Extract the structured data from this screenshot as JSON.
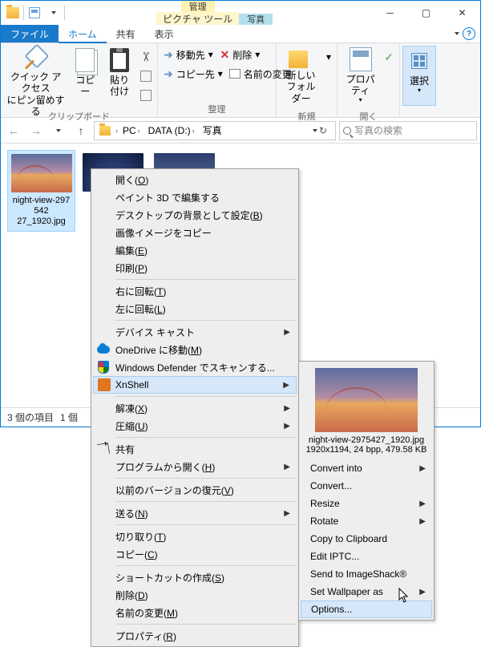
{
  "titlebar": {
    "contextual": [
      {
        "header": "管理",
        "tab": "ピクチャ ツール",
        "color": "yellow"
      },
      {
        "header": "写真",
        "tab": "",
        "color": "cyan"
      }
    ]
  },
  "ribbon_tabs": {
    "file": "ファイル",
    "home": "ホーム",
    "share": "共有",
    "view": "表示"
  },
  "ribbon": {
    "clipboard": {
      "label": "クリップボード",
      "pin": "クイック アクセス\nにピン留めする",
      "copy": "コピー",
      "paste": "貼り付け"
    },
    "organize": {
      "label": "整理",
      "move": "移動先",
      "delete": "削除",
      "copy_to": "コピー先",
      "rename": "名前の変更"
    },
    "new": {
      "label": "新規",
      "newfolder": "新しい\nフォルダー"
    },
    "open": {
      "label": "開く",
      "props": "プロパティ"
    },
    "select": {
      "label": "",
      "btn": "選択"
    }
  },
  "breadcrumbs": [
    "PC",
    "DATA (D:)",
    "写真"
  ],
  "search_placeholder": "写真の検索",
  "files": [
    {
      "name": "night-view-297542\n27_1920.jpg",
      "imgclass": "img-bridge"
    },
    {
      "name": "",
      "imgclass": "img-sky"
    },
    {
      "name": "",
      "imgclass": "img-city"
    }
  ],
  "statusbar": {
    "count": "3 個の項目",
    "selected": "1 個"
  },
  "context_menu_1": [
    {
      "type": "item",
      "label": "開く",
      "accel": "O"
    },
    {
      "type": "item",
      "label": "ペイント 3D で編集する"
    },
    {
      "type": "item",
      "label": "デスクトップの背景として設定",
      "accel": "B"
    },
    {
      "type": "item",
      "label": "画像イメージをコピー"
    },
    {
      "type": "item",
      "label": "編集",
      "accel": "E"
    },
    {
      "type": "item",
      "label": "印刷",
      "accel": "P"
    },
    {
      "type": "sep"
    },
    {
      "type": "item",
      "label": "右に回転",
      "accel": "T"
    },
    {
      "type": "item",
      "label": "左に回転",
      "accel": "L"
    },
    {
      "type": "sep"
    },
    {
      "type": "item",
      "label": "デバイス キャスト",
      "submenu": true
    },
    {
      "type": "item",
      "label": "OneDrive に移動",
      "accel": "M",
      "icon": "onedrive"
    },
    {
      "type": "item",
      "label": "Windows Defender でスキャンする...",
      "icon": "shield"
    },
    {
      "type": "item",
      "label": "XnShell",
      "submenu": true,
      "icon": "xn",
      "hover": true
    },
    {
      "type": "sep"
    },
    {
      "type": "item",
      "label": "解凍",
      "accel": "X",
      "submenu": true
    },
    {
      "type": "item",
      "label": "圧縮",
      "accel": "U",
      "submenu": true
    },
    {
      "type": "sep"
    },
    {
      "type": "item",
      "label": "共有",
      "icon": "share"
    },
    {
      "type": "item",
      "label": "プログラムから開く",
      "accel": "H",
      "submenu": true
    },
    {
      "type": "sep"
    },
    {
      "type": "item",
      "label": "以前のバージョンの復元",
      "accel": "V"
    },
    {
      "type": "sep"
    },
    {
      "type": "item",
      "label": "送る",
      "accel": "N",
      "submenu": true
    },
    {
      "type": "sep"
    },
    {
      "type": "item",
      "label": "切り取り",
      "accel": "T"
    },
    {
      "type": "item",
      "label": "コピー",
      "accel": "C"
    },
    {
      "type": "sep"
    },
    {
      "type": "item",
      "label": "ショートカットの作成",
      "accel": "S"
    },
    {
      "type": "item",
      "label": "削除",
      "accel": "D"
    },
    {
      "type": "item",
      "label": "名前の変更",
      "accel": "M"
    },
    {
      "type": "sep"
    },
    {
      "type": "item",
      "label": "プロパティ",
      "accel": "R"
    }
  ],
  "submenu_preview": {
    "name": "night-view-2975427_1920.jpg",
    "meta": "1920x1194, 24 bpp, 479.58 KB"
  },
  "context_menu_2": [
    {
      "label": "Convert into",
      "submenu": true
    },
    {
      "label": "Convert..."
    },
    {
      "label": "Resize",
      "submenu": true
    },
    {
      "label": "Rotate",
      "submenu": true
    },
    {
      "label": "Copy to Clipboard"
    },
    {
      "label": "Edit IPTC..."
    },
    {
      "label": "Send to ImageShack®"
    },
    {
      "label": "Set Wallpaper as",
      "submenu": true
    },
    {
      "label": "Options...",
      "hover": true
    }
  ]
}
